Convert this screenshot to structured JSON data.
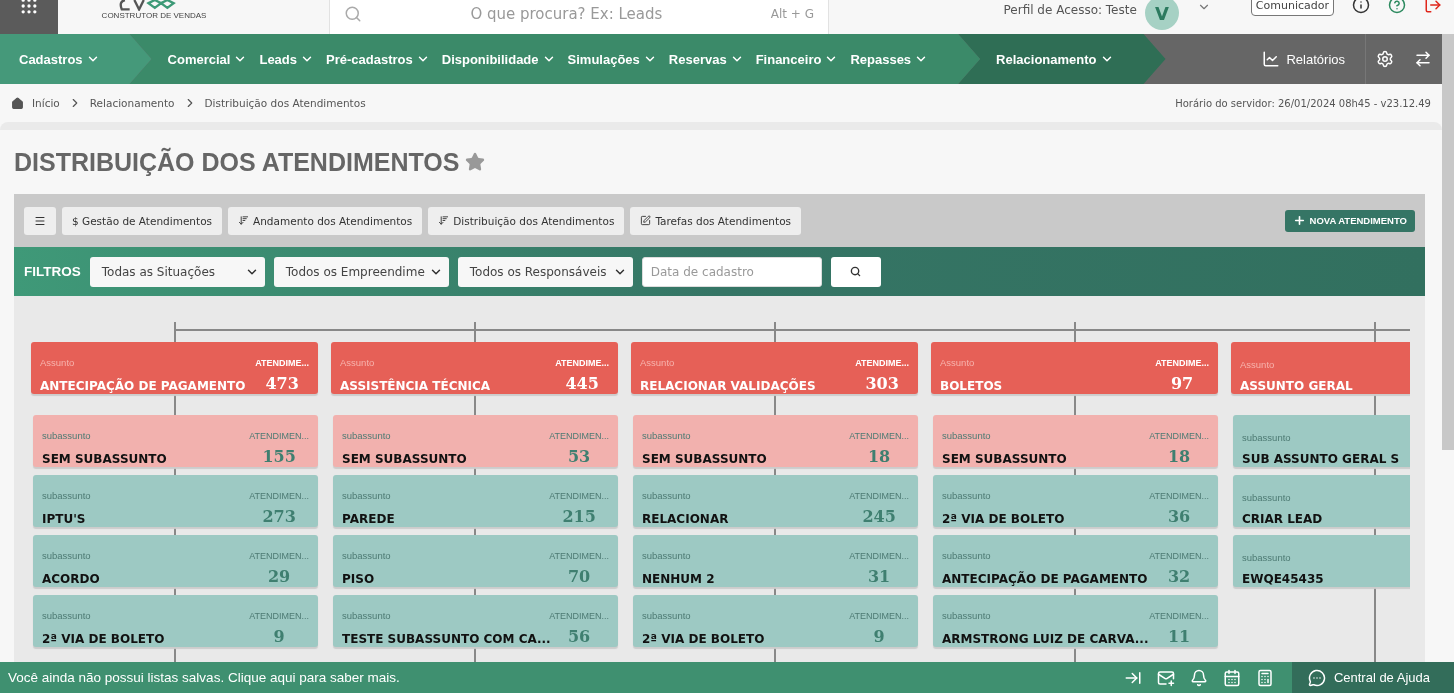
{
  "header": {
    "logo_caption": "CONSTRUTOR DE VENDAS",
    "search": {
      "placeholder": "O que procura? Ex: Leads",
      "shortcut": "Alt + G"
    },
    "profile": "Perfil de Acesso: Teste",
    "avatar": "V",
    "communicator": "Comunicador"
  },
  "nav": {
    "items": [
      {
        "label": "Cadastros",
        "selected": false
      },
      {
        "label": "Comercial",
        "selected": false
      },
      {
        "label": "Leads",
        "selected": false
      },
      {
        "label": "Pré-cadastros",
        "selected": false
      },
      {
        "label": "Disponibilidade",
        "selected": false
      },
      {
        "label": "Simulações",
        "selected": false
      },
      {
        "label": "Reservas",
        "selected": false
      },
      {
        "label": "Financeiro",
        "selected": false
      },
      {
        "label": "Repasses",
        "selected": false
      },
      {
        "label": "Relacionamento",
        "selected": true
      }
    ],
    "reports": "Relatórios"
  },
  "breadcrumb": [
    "Início",
    "Relacionamento",
    "Distribuição dos Atendimentos"
  ],
  "server_time": "Horário do servidor: 26/01/2024 08h45 - v23.12.49",
  "page_title": "DISTRIBUIÇÃO DOS ATENDIMENTOS",
  "toolbar": {
    "tabs": [
      {
        "label": "$ Gestão de Atendimentos",
        "kind": "plain"
      },
      {
        "label": "Andamento dos Atendimentos",
        "kind": "sort"
      },
      {
        "label": "Distribuição dos Atendimentos",
        "kind": "sort"
      },
      {
        "label": "Tarefas dos Atendimentos",
        "kind": "edit"
      }
    ],
    "new_button": "NOVA ATENDIMENTO"
  },
  "filters": {
    "label": "FILTROS",
    "selects": [
      "Todas as Situações",
      "Todos os Empreendime",
      "Todos os Responsáveis"
    ],
    "date": {
      "placeholder": "Data de cadastro"
    }
  },
  "board": {
    "columns": [
      {
        "subject_label": "Assunto",
        "title": "ANTECIPAÇÃO DE PAGAMENTO",
        "count_label": "ATENDIME...",
        "count": "473",
        "subs": [
          {
            "label": "subassunto",
            "title": "SEM SUBASSUNTO",
            "count_label": "ATENDIMEN...",
            "count": "155",
            "kind": "empty"
          },
          {
            "label": "subassunto",
            "title": "IPTU'S",
            "count_label": "ATENDIMEN...",
            "count": "273",
            "kind": "regular"
          },
          {
            "label": "subassunto",
            "title": "ACORDO",
            "count_label": "ATENDIMEN...",
            "count": "29",
            "kind": "regular"
          },
          {
            "label": "subassunto",
            "title": "2ª VIA DE BOLETO",
            "count_label": "ATENDIMEN...",
            "count": "9",
            "kind": "regular"
          }
        ]
      },
      {
        "subject_label": "Assunto",
        "title": "ASSISTÊNCIA TÉCNICA",
        "count_label": "ATENDIME...",
        "count": "445",
        "subs": [
          {
            "label": "subassunto",
            "title": "SEM SUBASSUNTO",
            "count_label": "ATENDIMEN...",
            "count": "53",
            "kind": "empty"
          },
          {
            "label": "subassunto",
            "title": "PAREDE",
            "count_label": "ATENDIMEN...",
            "count": "215",
            "kind": "regular"
          },
          {
            "label": "subassunto",
            "title": "PISO",
            "count_label": "ATENDIMEN...",
            "count": "70",
            "kind": "regular"
          },
          {
            "label": "subassunto",
            "title": "TESTE SUBASSUNTO COM CA...",
            "count_label": "ATENDIMEN...",
            "count": "56",
            "kind": "regular"
          }
        ]
      },
      {
        "subject_label": "Assunto",
        "title": "RELACIONAR VALIDAÇÕES",
        "count_label": "ATENDIME...",
        "count": "303",
        "subs": [
          {
            "label": "subassunto",
            "title": "SEM SUBASSUNTO",
            "count_label": "ATENDIMEN...",
            "count": "18",
            "kind": "empty"
          },
          {
            "label": "subassunto",
            "title": "RELACIONAR",
            "count_label": "ATENDIMEN...",
            "count": "245",
            "kind": "regular"
          },
          {
            "label": "subassunto",
            "title": "NENHUM 2",
            "count_label": "ATENDIMEN...",
            "count": "31",
            "kind": "regular"
          },
          {
            "label": "subassunto",
            "title": "2ª VIA DE BOLETO",
            "count_label": "ATENDIMEN...",
            "count": "9",
            "kind": "regular"
          }
        ]
      },
      {
        "subject_label": "Assunto",
        "title": "BOLETOS",
        "count_label": "ATENDIME...",
        "count": "97",
        "subs": [
          {
            "label": "subassunto",
            "title": "SEM SUBASSUNTO",
            "count_label": "ATENDIMEN...",
            "count": "18",
            "kind": "empty"
          },
          {
            "label": "subassunto",
            "title": "2ª VIA DE BOLETO",
            "count_label": "ATENDIMEN...",
            "count": "36",
            "kind": "regular"
          },
          {
            "label": "subassunto",
            "title": "ANTECIPAÇÃO DE PAGAMENTO",
            "count_label": "ATENDIMEN...",
            "count": "32",
            "kind": "regular"
          },
          {
            "label": "subassunto",
            "title": "ARMSTRONG LUIZ DE CARVA...",
            "count_label": "ATENDIMEN...",
            "count": "11",
            "kind": "regular"
          }
        ]
      },
      {
        "subject_label": "Assunto",
        "title": "ASSUNTO GERAL",
        "subs": [
          {
            "label": "subassunto",
            "title": "SUB ASSUNTO GERAL S",
            "kind": "regular"
          },
          {
            "label": "subassunto",
            "title": "CRIAR LEAD",
            "kind": "regular"
          },
          {
            "label": "subassunto",
            "title": "EWQE45435",
            "kind": "regular"
          }
        ]
      }
    ]
  },
  "footer": {
    "message": "Você ainda não possui listas salvas. Clique aqui para saber mais.",
    "help": "Central de Ajuda"
  }
}
